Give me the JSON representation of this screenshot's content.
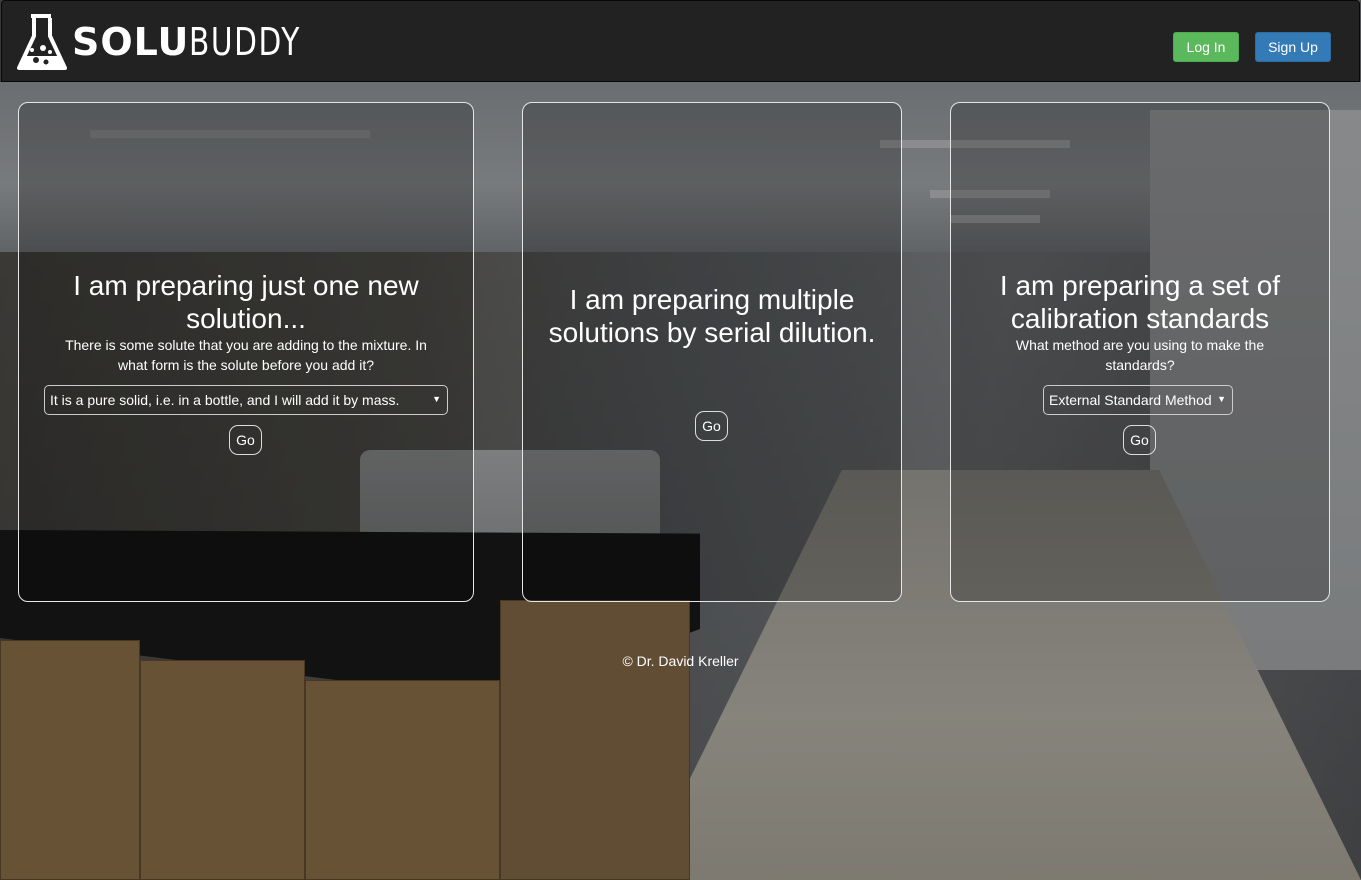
{
  "brand": {
    "name_bold": "SOLU",
    "name_light": "BUDDY",
    "logo_icon": "flask-icon"
  },
  "nav": {
    "login_label": "Log In",
    "signup_label": "Sign Up",
    "login_color": "#5cb85c",
    "signup_color": "#337ab7"
  },
  "cards": [
    {
      "title": "I am preparing just one new solution...",
      "subtitle": "There is some solute that you are adding to the mixture. In what form is the solute before you add it?",
      "select_value": "It is a pure solid, i.e. in a bottle, and I will add it by mass.",
      "go_label": "Go"
    },
    {
      "title": "I am preparing multiple solutions by serial dilution.",
      "go_label": "Go"
    },
    {
      "title": "I am preparing a set of calibration standards",
      "subtitle": "What method are you using to make the standards?",
      "select_value": "External Standard Method",
      "go_label": "Go"
    }
  ],
  "footer": {
    "copyright": "© Dr. David Kreller"
  }
}
